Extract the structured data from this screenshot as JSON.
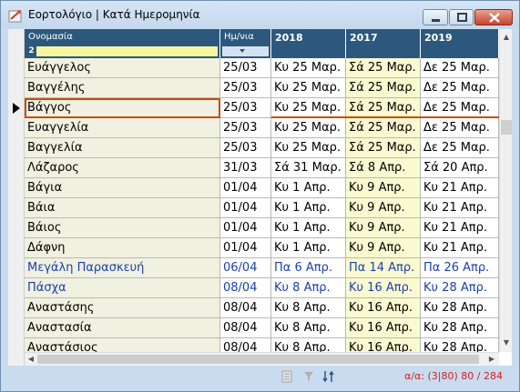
{
  "window": {
    "title": "Εορτολόγιο | Κατά Ημερομηνία",
    "buttons": [
      "minimize",
      "maximize",
      "close"
    ]
  },
  "grid": {
    "columns": {
      "name": "Ονομασία",
      "date": "Ημ/νια",
      "y1": "2018",
      "y2": "2017",
      "y3": "2019"
    },
    "sort_badge": "2",
    "rows": [
      {
        "name": "Ευάγγελος",
        "date": "25/03",
        "y1": "Κυ 25 Μαρ.",
        "y2": "Σά 25 Μαρ.",
        "y3": "Δε 25 Μαρ.",
        "highlight": false,
        "selected": false
      },
      {
        "name": "Βαγγέλης",
        "date": "25/03",
        "y1": "Κυ 25 Μαρ.",
        "y2": "Σά 25 Μαρ.",
        "y3": "Δε 25 Μαρ.",
        "highlight": false,
        "selected": false
      },
      {
        "name": "Βάγγος",
        "date": "25/03",
        "y1": "Κυ 25 Μαρ.",
        "y2": "Σά 25 Μαρ.",
        "y3": "Δε 25 Μαρ.",
        "highlight": false,
        "selected": true
      },
      {
        "name": "Ευαγγελία",
        "date": "25/03",
        "y1": "Κυ 25 Μαρ.",
        "y2": "Σά 25 Μαρ.",
        "y3": "Δε 25 Μαρ.",
        "highlight": false,
        "selected": false
      },
      {
        "name": "Βαγγελία",
        "date": "25/03",
        "y1": "Κυ 25 Μαρ.",
        "y2": "Σά 25 Μαρ.",
        "y3": "Δε 25 Μαρ.",
        "highlight": false,
        "selected": false
      },
      {
        "name": "Λάζαρος",
        "date": "31/03",
        "y1": "Σά 31 Μαρ.",
        "y2": "Σά 8 Απρ.",
        "y3": "Σά 20 Απρ.",
        "highlight": false,
        "selected": false
      },
      {
        "name": "Βάγια",
        "date": "01/04",
        "y1": "Κυ 1 Απρ.",
        "y2": "Κυ 9 Απρ.",
        "y3": "Κυ 21 Απρ.",
        "highlight": false,
        "selected": false
      },
      {
        "name": "Βάια",
        "date": "01/04",
        "y1": "Κυ 1 Απρ.",
        "y2": "Κυ 9 Απρ.",
        "y3": "Κυ 21 Απρ.",
        "highlight": false,
        "selected": false
      },
      {
        "name": "Βάιος",
        "date": "01/04",
        "y1": "Κυ 1 Απρ.",
        "y2": "Κυ 9 Απρ.",
        "y3": "Κυ 21 Απρ.",
        "highlight": false,
        "selected": false
      },
      {
        "name": "Δάφνη",
        "date": "01/04",
        "y1": "Κυ 1 Απρ.",
        "y2": "Κυ 9 Απρ.",
        "y3": "Κυ 21 Απρ.",
        "highlight": false,
        "selected": false
      },
      {
        "name": "Μεγάλη Παρασκευή",
        "date": "06/04",
        "y1": "Πα 6 Απρ.",
        "y2": "Πα 14 Απρ.",
        "y3": "Πα 26 Απρ.",
        "highlight": true,
        "selected": false
      },
      {
        "name": "Πάσχα",
        "date": "08/04",
        "y1": "Κυ 8 Απρ.",
        "y2": "Κυ 16 Απρ.",
        "y3": "Κυ 28 Απρ.",
        "highlight": true,
        "selected": false
      },
      {
        "name": "Αναστάσης",
        "date": "08/04",
        "y1": "Κυ 8 Απρ.",
        "y2": "Κυ 16 Απρ.",
        "y3": "Κυ 28 Απρ.",
        "highlight": false,
        "selected": false
      },
      {
        "name": "Αναστασία",
        "date": "08/04",
        "y1": "Κυ 8 Απρ.",
        "y2": "Κυ 16 Απρ.",
        "y3": "Κυ 28 Απρ.",
        "highlight": false,
        "selected": false
      },
      {
        "name": "Αναστάσιος",
        "date": "08/04",
        "y1": "Κυ 8 Απρ.",
        "y2": "Κυ 16 Απρ.",
        "y3": "Κυ 28 Απρ.",
        "highlight": false,
        "selected": false
      }
    ]
  },
  "status": {
    "position_text": "α/α: (3|80) 80 / 284",
    "icons": [
      "list-icon",
      "filter-icon",
      "sort-icon"
    ]
  },
  "colors": {
    "header_bg": "#2c587d",
    "highlight_text": "#1a3fb0",
    "selection_border": "#cc4a10",
    "status_text": "#d11f1f"
  }
}
